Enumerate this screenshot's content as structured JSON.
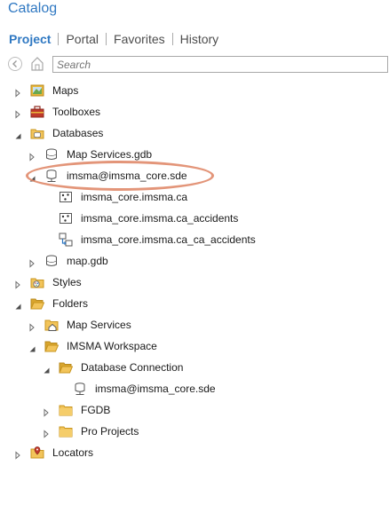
{
  "panel": {
    "title": "Catalog"
  },
  "tabs": [
    {
      "label": "Project",
      "active": true
    },
    {
      "label": "Portal",
      "active": false
    },
    {
      "label": "Favorites",
      "active": false
    },
    {
      "label": "History",
      "active": false
    }
  ],
  "search": {
    "placeholder": "Search"
  },
  "colors": {
    "accent": "#2f78c2",
    "highlight": "#e0896a",
    "folder": "#e8b73a"
  },
  "tree": [
    {
      "label": "Maps",
      "level": 0,
      "state": "collapsed",
      "icon": "maps-icon"
    },
    {
      "label": "Toolboxes",
      "level": 0,
      "state": "collapsed",
      "icon": "toolbox-icon"
    },
    {
      "label": "Databases",
      "level": 0,
      "state": "expanded",
      "icon": "folder-db-icon"
    },
    {
      "label": "Map Services.gdb",
      "level": 1,
      "state": "collapsed",
      "icon": "database-icon"
    },
    {
      "label": "imsma@imsma_core.sde",
      "level": 1,
      "state": "expanded",
      "icon": "db-connection-icon",
      "highlighted": true
    },
    {
      "label": "imsma_core.imsma.ca",
      "level": 2,
      "state": "none",
      "icon": "point-featureclass-icon"
    },
    {
      "label": "imsma_core.imsma.ca_accidents",
      "level": 2,
      "state": "none",
      "icon": "point-featureclass-icon"
    },
    {
      "label": "imsma_core.imsma.ca_ca_accidents",
      "level": 2,
      "state": "none",
      "icon": "relationship-class-icon"
    },
    {
      "label": "map.gdb",
      "level": 1,
      "state": "collapsed",
      "icon": "database-icon"
    },
    {
      "label": "Styles",
      "level": 0,
      "state": "collapsed",
      "icon": "styles-icon"
    },
    {
      "label": "Folders",
      "level": 0,
      "state": "expanded",
      "icon": "folder-open-icon"
    },
    {
      "label": "Map Services",
      "level": 1,
      "state": "collapsed",
      "icon": "folder-home-icon"
    },
    {
      "label": "IMSMA Workspace",
      "level": 1,
      "state": "expanded",
      "icon": "folder-open-icon"
    },
    {
      "label": "Database Connection",
      "level": 2,
      "state": "expanded",
      "icon": "folder-open-icon"
    },
    {
      "label": "imsma@imsma_core.sde",
      "level": 3,
      "state": "none",
      "icon": "db-connection-icon"
    },
    {
      "label": "FGDB",
      "level": 2,
      "state": "collapsed",
      "icon": "folder-icon"
    },
    {
      "label": "Pro Projects",
      "level": 2,
      "state": "collapsed",
      "icon": "folder-icon"
    },
    {
      "label": "Locators",
      "level": 0,
      "state": "collapsed",
      "icon": "locator-icon"
    }
  ]
}
